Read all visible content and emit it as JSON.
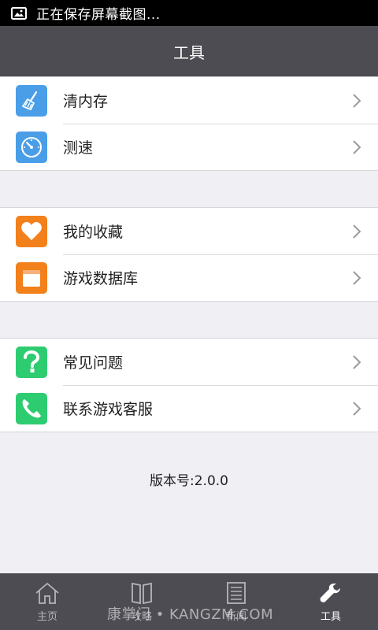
{
  "status_bar": {
    "text": "正在保存屏幕截图...",
    "icon": "image-icon"
  },
  "header": {
    "title": "工具"
  },
  "groups": [
    {
      "items": [
        {
          "label": "清内存",
          "icon": "broom-icon",
          "color": "#4a9ee8"
        },
        {
          "label": "测速",
          "icon": "speedometer-icon",
          "color": "#4a9ee8"
        }
      ]
    },
    {
      "items": [
        {
          "label": "我的收藏",
          "icon": "heart-icon",
          "color": "#f2801b"
        },
        {
          "label": "游戏数据库",
          "icon": "database-icon",
          "color": "#f2801b"
        }
      ]
    },
    {
      "items": [
        {
          "label": "常见问题",
          "icon": "question-icon",
          "color": "#2ecc71"
        },
        {
          "label": "联系游戏客服",
          "icon": "phone-icon",
          "color": "#2ecc71"
        }
      ]
    }
  ],
  "version": "版本号:2.0.0",
  "tabs": [
    {
      "label": "主页",
      "icon": "home-icon"
    },
    {
      "label": "攻略",
      "icon": "book-icon"
    },
    {
      "label": "新闻",
      "icon": "news-icon"
    },
    {
      "label": "工具",
      "icon": "wrench-icon",
      "active": true
    }
  ],
  "watermark": "康掌门 • KANGZM.COM"
}
